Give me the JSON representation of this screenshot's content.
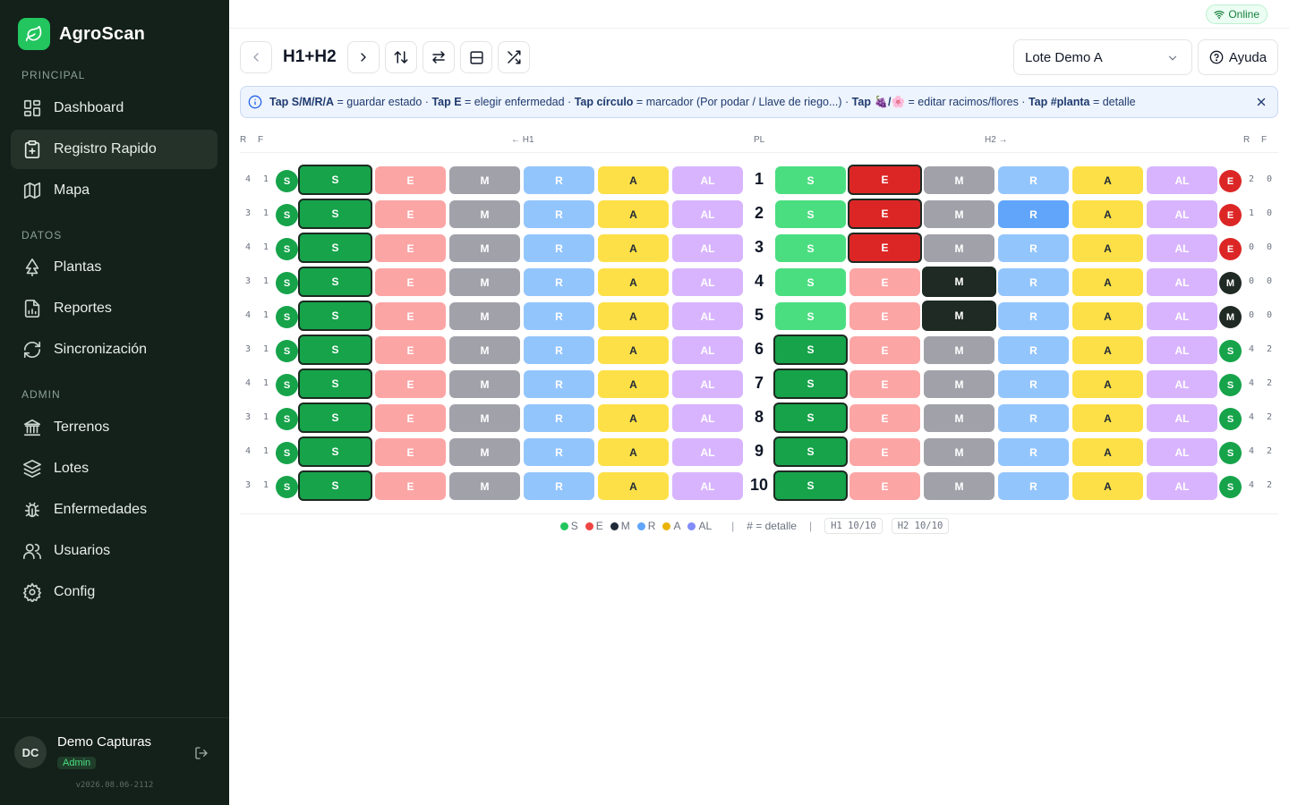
{
  "app": {
    "name": "AgroScan"
  },
  "sidebar": {
    "sections": [
      {
        "label": "PRINCIPAL",
        "items": [
          {
            "label": "Dashboard",
            "icon": "dashboard-icon"
          },
          {
            "label": "Registro Rapido",
            "icon": "clipboard-plus-icon",
            "active": true
          },
          {
            "label": "Mapa",
            "icon": "map-icon"
          }
        ]
      },
      {
        "label": "DATOS",
        "items": [
          {
            "label": "Plantas",
            "icon": "tree-icon"
          },
          {
            "label": "Reportes",
            "icon": "report-icon"
          },
          {
            "label": "Sincronización",
            "icon": "sync-icon"
          }
        ]
      },
      {
        "label": "ADMIN",
        "items": [
          {
            "label": "Terrenos",
            "icon": "building-icon"
          },
          {
            "label": "Lotes",
            "icon": "layers-icon"
          },
          {
            "label": "Enfermedades",
            "icon": "bug-icon"
          },
          {
            "label": "Usuarios",
            "icon": "users-icon"
          },
          {
            "label": "Config",
            "icon": "gear-icon"
          }
        ]
      }
    ],
    "user": {
      "initials": "DC",
      "name": "Demo Capturas",
      "role": "Admin"
    },
    "version": "v2026.08.06-2112"
  },
  "topbar": {
    "status": "Online"
  },
  "toolbar": {
    "title": "H1+H2",
    "lote": "Lote Demo A",
    "help": "Ayuda"
  },
  "banner": {
    "parts": [
      {
        "b": "Tap S/M/R/A",
        "t": " = guardar estado · "
      },
      {
        "b": "Tap E",
        "t": " = elegir enfermedad · "
      },
      {
        "b": "Tap círculo",
        "t": " = marcador (Por podar / Llave de riego...) · "
      },
      {
        "b": "Tap 🍇/🌸",
        "t": " = editar racimos/flores · "
      },
      {
        "b": "Tap #planta",
        "t": " = detalle"
      }
    ]
  },
  "grid_header": {
    "r": "R",
    "f": "F",
    "h1": "← H1",
    "pl": "PL",
    "h2": "H2 →"
  },
  "states": [
    "S",
    "E",
    "M",
    "R",
    "A",
    "AL"
  ],
  "colors": {
    "S": {
      "light": "#4ade80",
      "dark": "#16a34a",
      "text": "#ffffff"
    },
    "E": {
      "light": "#fca5a5",
      "dark": "#dc2626",
      "text": "#ffffff"
    },
    "M": {
      "light": "#a1a1aa",
      "dark": "#1f2a24",
      "text": "#ffffff"
    },
    "R": {
      "light": "#93c5fd",
      "dark": "#60a5fa",
      "text": "#ffffff"
    },
    "A": {
      "light": "#fde047",
      "dark": "#facc15",
      "text": "#1f2937"
    },
    "AL": {
      "light": "#d8b4fe",
      "dark": "#c084fc",
      "text": "#ffffff"
    }
  },
  "rows": [
    {
      "plant": "1",
      "h1": {
        "r": "4",
        "f": "1",
        "marker": "S",
        "sel": "S"
      },
      "h2": {
        "r": "2",
        "f": "0",
        "marker": "E",
        "sel": "E"
      }
    },
    {
      "plant": "2",
      "h1": {
        "r": "3",
        "f": "1",
        "marker": "S",
        "sel": "S"
      },
      "h2": {
        "r": "1",
        "f": "0",
        "marker": "E",
        "sel": "E",
        "hl": "R"
      }
    },
    {
      "plant": "3",
      "h1": {
        "r": "4",
        "f": "1",
        "marker": "S",
        "sel": "S"
      },
      "h2": {
        "r": "0",
        "f": "0",
        "marker": "E",
        "sel": "E"
      }
    },
    {
      "plant": "4",
      "h1": {
        "r": "3",
        "f": "1",
        "marker": "S",
        "sel": "S"
      },
      "h2": {
        "r": "0",
        "f": "0",
        "marker": "M",
        "sel": "M"
      }
    },
    {
      "plant": "5",
      "h1": {
        "r": "4",
        "f": "1",
        "marker": "S",
        "sel": "S"
      },
      "h2": {
        "r": "0",
        "f": "0",
        "marker": "M",
        "sel": "M"
      }
    },
    {
      "plant": "6",
      "h1": {
        "r": "3",
        "f": "1",
        "marker": "S",
        "sel": "S"
      },
      "h2": {
        "r": "4",
        "f": "2",
        "marker": "S",
        "sel": "S"
      }
    },
    {
      "plant": "7",
      "h1": {
        "r": "4",
        "f": "1",
        "marker": "S",
        "sel": "S"
      },
      "h2": {
        "r": "4",
        "f": "2",
        "marker": "S",
        "sel": "S"
      }
    },
    {
      "plant": "8",
      "h1": {
        "r": "3",
        "f": "1",
        "marker": "S",
        "sel": "S"
      },
      "h2": {
        "r": "4",
        "f": "2",
        "marker": "S",
        "sel": "S"
      }
    },
    {
      "plant": "9",
      "h1": {
        "r": "4",
        "f": "1",
        "marker": "S",
        "sel": "S"
      },
      "h2": {
        "r": "4",
        "f": "2",
        "marker": "S",
        "sel": "S"
      }
    },
    {
      "plant": "10",
      "h1": {
        "r": "3",
        "f": "1",
        "marker": "S",
        "sel": "S"
      },
      "h2": {
        "r": "4",
        "f": "2",
        "marker": "S",
        "sel": "S"
      }
    }
  ],
  "legend": {
    "items": [
      {
        "label": "S",
        "color": "#22c55e"
      },
      {
        "label": "E",
        "color": "#ef4444"
      },
      {
        "label": "M",
        "color": "#1f2937"
      },
      {
        "label": "R",
        "color": "#60a5fa"
      },
      {
        "label": "A",
        "color": "#eab308"
      },
      {
        "label": "AL",
        "color": "#818cf8"
      }
    ],
    "detail": "# = detalle",
    "separator": "|",
    "h1_count": "H1 10/10",
    "h2_count": "H2 10/10"
  }
}
